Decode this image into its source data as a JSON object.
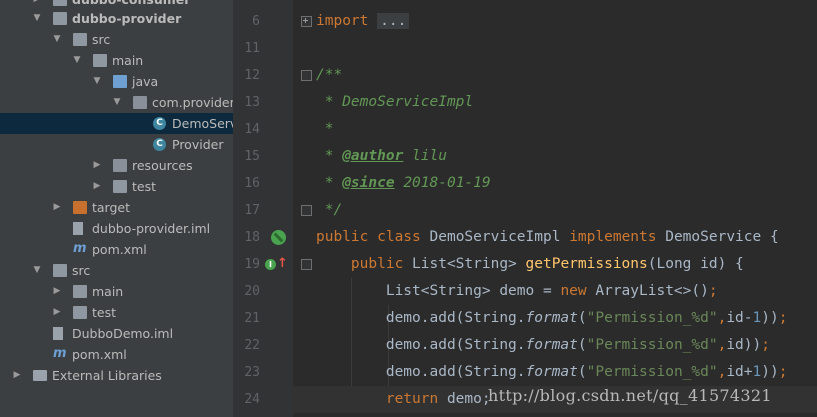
{
  "project_tree": {
    "items": [
      {
        "label": "dubbo-consumer",
        "icon": "module-folder-icon",
        "expanded": false,
        "selected": false
      },
      {
        "label": "dubbo-provider",
        "icon": "module-folder-icon",
        "expanded": true,
        "selected": false
      },
      {
        "label": "src",
        "icon": "folder-icon",
        "expanded": true,
        "selected": false
      },
      {
        "label": "main",
        "icon": "folder-icon",
        "expanded": true,
        "selected": false
      },
      {
        "label": "java",
        "icon": "source-folder-icon",
        "expanded": true,
        "selected": false
      },
      {
        "label": "com.provider",
        "icon": "package-icon",
        "expanded": true,
        "selected": false
      },
      {
        "label": "DemoServiceI",
        "icon": "class-icon",
        "expanded": false,
        "selected": true
      },
      {
        "label": "Provider",
        "icon": "class-icon",
        "expanded": false,
        "selected": false
      },
      {
        "label": "resources",
        "icon": "resources-folder-icon",
        "expanded": false,
        "selected": false
      },
      {
        "label": "test",
        "icon": "folder-icon",
        "expanded": false,
        "selected": false
      },
      {
        "label": "target",
        "icon": "excluded-folder-icon",
        "expanded": false,
        "selected": false
      },
      {
        "label": "dubbo-provider.iml",
        "icon": "iml-file-icon",
        "expanded": false,
        "selected": false
      },
      {
        "label": "pom.xml",
        "icon": "maven-icon",
        "expanded": false,
        "selected": false
      },
      {
        "label": "src",
        "icon": "folder-icon",
        "expanded": true,
        "selected": false
      },
      {
        "label": "main",
        "icon": "folder-icon",
        "expanded": false,
        "selected": false
      },
      {
        "label": "test",
        "icon": "folder-icon",
        "expanded": false,
        "selected": false
      },
      {
        "label": "DubboDemo.iml",
        "icon": "iml-file-icon",
        "expanded": false,
        "selected": false
      },
      {
        "label": "pom.xml",
        "icon": "maven-icon",
        "expanded": false,
        "selected": false
      },
      {
        "label": "External Libraries",
        "icon": "libraries-icon",
        "expanded": false,
        "selected": false
      }
    ],
    "class_badge": "C"
  },
  "gutter": {
    "line_numbers": [
      "6",
      "11",
      "12",
      "13",
      "14",
      "15",
      "16",
      "17",
      "18",
      "19",
      "20",
      "21",
      "22",
      "23",
      "24"
    ],
    "implements_badge": "I",
    "up_arrow": "↑"
  },
  "editor": {
    "lines": [
      [
        {
          "t": "import ",
          "c": "kw"
        },
        {
          "t": "...",
          "c": "fold-pill"
        }
      ],
      [],
      [
        {
          "t": "/**",
          "c": "cm"
        }
      ],
      [
        {
          "t": " * DemoServiceImpl",
          "c": "cm"
        }
      ],
      [
        {
          "t": " *",
          "c": "cm"
        }
      ],
      [
        {
          "t": " * ",
          "c": "cm"
        },
        {
          "t": "@author",
          "c": "tag"
        },
        {
          "t": " lilu",
          "c": "cm"
        }
      ],
      [
        {
          "t": " * ",
          "c": "cm"
        },
        {
          "t": "@since",
          "c": "tag"
        },
        {
          "t": " 2018-01-19",
          "c": "cm"
        }
      ],
      [
        {
          "t": " */",
          "c": "cm"
        }
      ],
      [
        {
          "t": "public class ",
          "c": "kw"
        },
        {
          "t": "DemoServiceImpl ",
          "c": ""
        },
        {
          "t": "implements ",
          "c": "kw"
        },
        {
          "t": "DemoService {",
          "c": ""
        }
      ],
      [
        {
          "t": "    public ",
          "c": "kw"
        },
        {
          "t": "List<String> ",
          "c": ""
        },
        {
          "t": "getPermissions",
          "c": "fn"
        },
        {
          "t": "(Long id) {",
          "c": ""
        }
      ],
      [
        {
          "t": "        List<String> demo = ",
          "c": ""
        },
        {
          "t": "new ",
          "c": "kw"
        },
        {
          "t": "ArrayList<>()",
          "c": ""
        },
        {
          "t": ";",
          "c": "kw"
        }
      ],
      [
        {
          "t": "        demo.add(String.",
          "c": ""
        },
        {
          "t": "format",
          "c": "st"
        },
        {
          "t": "(",
          "c": ""
        },
        {
          "t": "\"Permission_%d\"",
          "c": "str"
        },
        {
          "t": ",",
          "c": "kw"
        },
        {
          "t": "id-",
          "c": ""
        },
        {
          "t": "1",
          "c": "num"
        },
        {
          "t": "))",
          "c": ""
        },
        {
          "t": ";",
          "c": "kw"
        }
      ],
      [
        {
          "t": "        demo.add(String.",
          "c": ""
        },
        {
          "t": "format",
          "c": "st"
        },
        {
          "t": "(",
          "c": ""
        },
        {
          "t": "\"Permission_%d\"",
          "c": "str"
        },
        {
          "t": ",",
          "c": "kw"
        },
        {
          "t": "id))",
          "c": ""
        },
        {
          "t": ";",
          "c": "kw"
        }
      ],
      [
        {
          "t": "        demo.add(String.",
          "c": ""
        },
        {
          "t": "format",
          "c": "st"
        },
        {
          "t": "(",
          "c": ""
        },
        {
          "t": "\"Permission_%d\"",
          "c": "str"
        },
        {
          "t": ",",
          "c": "kw"
        },
        {
          "t": "id+",
          "c": ""
        },
        {
          "t": "1",
          "c": "num"
        },
        {
          "t": "))",
          "c": ""
        },
        {
          "t": ";",
          "c": "kw"
        }
      ],
      [
        {
          "t": "        return ",
          "c": "kw"
        },
        {
          "t": "demo;",
          "c": ""
        }
      ]
    ]
  },
  "watermark": "http://blog.csdn.net/qq_41574321"
}
